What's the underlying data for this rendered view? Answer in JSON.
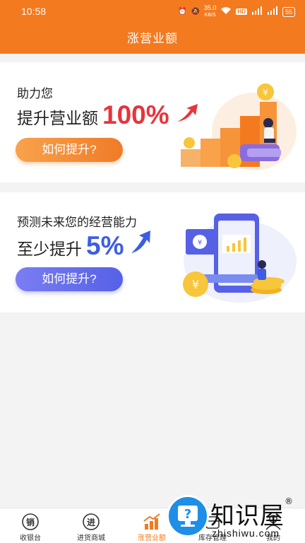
{
  "status_bar": {
    "time": "10:58",
    "network_speed": "35.0",
    "network_unit": "KB/S",
    "battery": "55"
  },
  "header": {
    "title": "涨营业额"
  },
  "cards": [
    {
      "subtitle": "助力您",
      "headline": "提升营业额",
      "percent": "100%",
      "button": "如何提升?"
    },
    {
      "subtitle": "预测未来您的经营能力",
      "headline": "至少提升",
      "percent": "5%",
      "button": "如何提升?"
    }
  ],
  "tabbar": {
    "items": [
      {
        "label": "收银台",
        "icon_text": "销",
        "icon": "cashier-icon"
      },
      {
        "label": "进货商城",
        "icon_text": "进",
        "icon": "purchase-icon"
      },
      {
        "label": "涨营业额",
        "icon": "growth-chart-icon",
        "active": true
      },
      {
        "label": "库存管理",
        "icon": "inventory-icon"
      },
      {
        "label": "我的",
        "icon": "profile-icon"
      }
    ]
  },
  "watermark": {
    "title": "知识屋",
    "mark": "®",
    "domain": "zhishiwu.com"
  },
  "colors": {
    "brand_orange": "#f47a1f",
    "highlight_red": "#e8343c",
    "highlight_blue": "#3d5de4"
  }
}
